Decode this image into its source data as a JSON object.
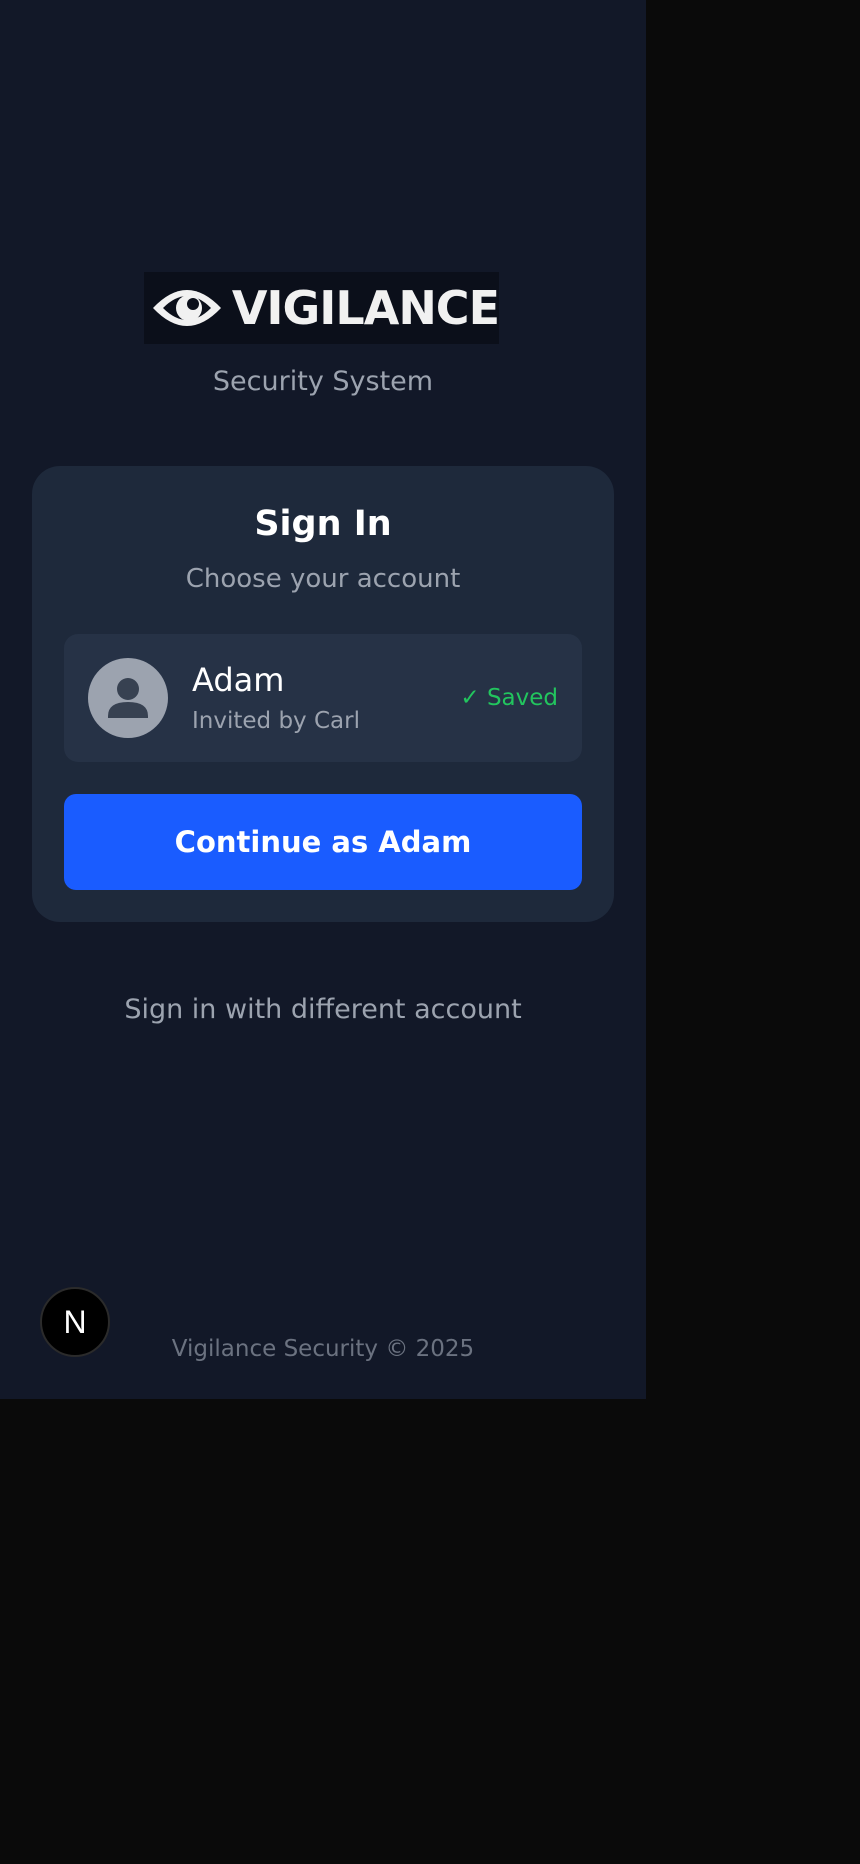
{
  "brand": {
    "logo_text": "VIGILANCE",
    "tagline": "Security System"
  },
  "signin": {
    "title": "Sign In",
    "subtitle": "Choose your account",
    "account": {
      "name": "Adam",
      "invited_by": "Invited by Carl",
      "status": "✓ Saved"
    },
    "continue_label": "Continue as Adam",
    "different_account_label": "Sign in with different account"
  },
  "footer": {
    "copyright": "Vigilance Security © 2025"
  },
  "dev_badge": {
    "label": "N"
  },
  "colors": {
    "page_background": "#121828",
    "card_background": "#1e293b",
    "primary_button": "#1a5cff",
    "saved_status": "#22c55e"
  }
}
